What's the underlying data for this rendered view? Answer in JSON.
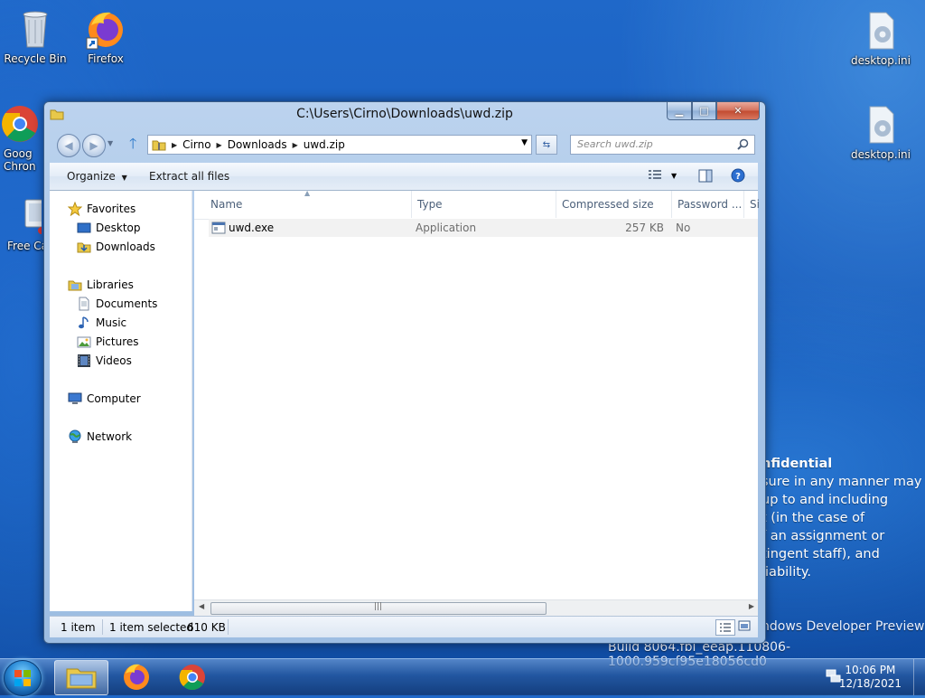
{
  "desktop": {
    "icons": [
      {
        "label": "Recycle Bin",
        "icon": "recycle-bin-icon"
      },
      {
        "label": "Firefox",
        "icon": "firefox-icon"
      },
      {
        "label": "Goog Chron",
        "icon": "chrome-icon"
      },
      {
        "label": "Free Ca",
        "icon": "computer-app-icon"
      },
      {
        "label": "desktop.ini",
        "icon": "settings-file-icon"
      },
      {
        "label": "desktop.ini",
        "icon": "settings-file-icon"
      }
    ],
    "watermark": {
      "heading": "nfidential",
      "lines": [
        "sure in any manner may",
        "up to and including",
        "t (in the case of",
        "f an assignment or",
        "tingent staff), and",
        "liability."
      ],
      "edition": "ndows Developer Preview",
      "build": "Build 8064.fbl_eeap.110806-1000.959cf95e18056cd0"
    }
  },
  "window": {
    "title": "C:\\Users\\Cirno\\Downloads\\uwd.zip",
    "caption": {
      "minimize": "▁",
      "maximize": "□",
      "close": "✕"
    },
    "breadcrumb": [
      "Cirno",
      "Downloads",
      "uwd.zip"
    ],
    "search_placeholder": "Search uwd.zip",
    "toolbar": {
      "organize": "Organize",
      "extract_all": "Extract all files"
    },
    "nav": {
      "favorites": "Favorites",
      "favorites_items": [
        "Desktop",
        "Downloads"
      ],
      "libraries": "Libraries",
      "libraries_items": [
        "Documents",
        "Music",
        "Pictures",
        "Videos"
      ],
      "computer": "Computer",
      "network": "Network"
    },
    "columns": [
      "Name",
      "Type",
      "Compressed size",
      "Password ...",
      "Si"
    ],
    "files": [
      {
        "name": "uwd.exe",
        "type": "Application",
        "compressed_size": "257 KB",
        "password": "No"
      }
    ],
    "status": {
      "count": "1 item",
      "selected": "1 item selected",
      "size": "610 KB"
    }
  },
  "taskbar": {
    "apps": [
      "windows-explorer-icon",
      "firefox-icon",
      "chrome-icon"
    ],
    "time": "10:06 PM",
    "date": "12/18/2021"
  },
  "colors": {
    "accent": "#1f68c9",
    "window_frame": "#a9c6e8",
    "row_selected": "#f2f2f2"
  }
}
